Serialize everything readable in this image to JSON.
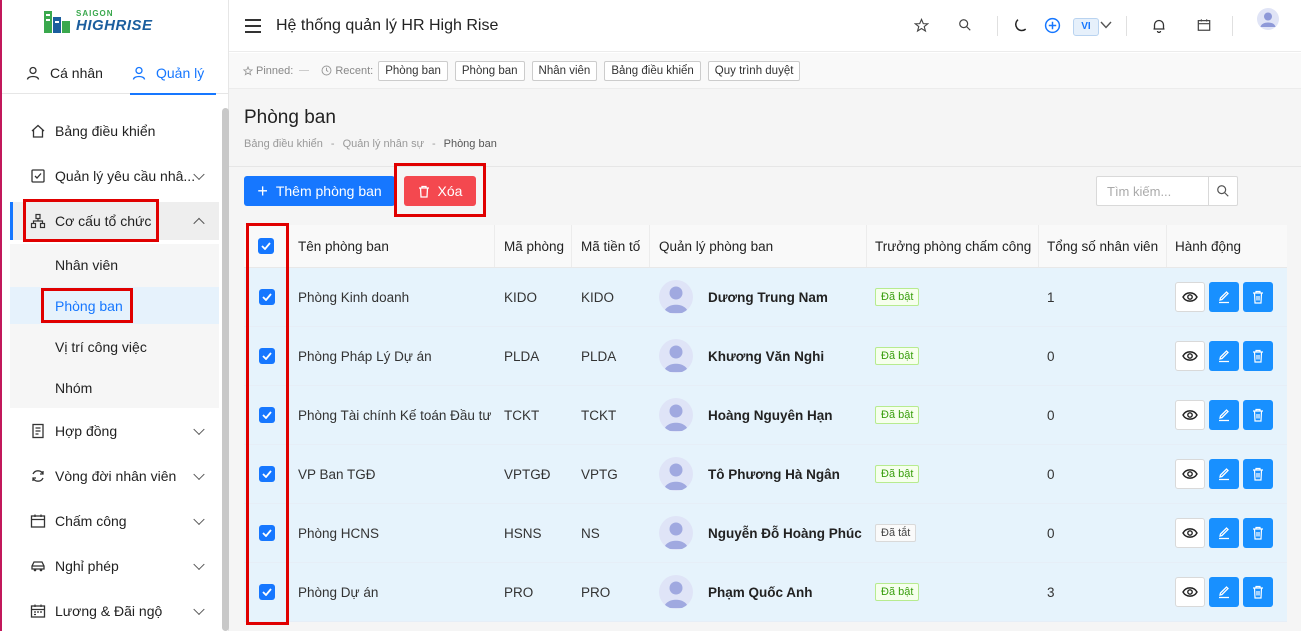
{
  "logo": {
    "sub": "SAIGON",
    "main": "HIGHRISE"
  },
  "sidebar": {
    "tabs": [
      {
        "label": "Cá nhân"
      },
      {
        "label": "Quản lý"
      }
    ],
    "items": [
      {
        "label": "Bảng điều khiển",
        "icon": "home-icon"
      },
      {
        "label": "Quản lý yêu cầu nhâ...",
        "icon": "checkbox-icon"
      },
      {
        "label": "Cơ cấu tổ chức",
        "icon": "org-chart-icon"
      },
      {
        "label": "Hợp đồng",
        "icon": "document-icon"
      },
      {
        "label": "Vòng đời nhân viên",
        "icon": "cycle-icon"
      },
      {
        "label": "Chấm công",
        "icon": "calendar-check-icon"
      },
      {
        "label": "Nghỉ phép",
        "icon": "car-icon"
      },
      {
        "label": "Lương & Đãi ngộ",
        "icon": "calendar-icon"
      }
    ],
    "submenu": [
      {
        "label": "Nhân viên"
      },
      {
        "label": "Phòng ban"
      },
      {
        "label": "Vị trí công việc"
      },
      {
        "label": "Nhóm"
      }
    ]
  },
  "header": {
    "title": "Hệ thống quản lý HR High Rise",
    "lang": "VI"
  },
  "recent_bar": {
    "pinned_label": "Pinned:",
    "recent_label": "Recent:",
    "chips": [
      "Phòng ban",
      "Phòng ban",
      "Nhân viên",
      "Bảng điều khiển",
      "Quy trình duyệt"
    ]
  },
  "page": {
    "title": "Phòng ban",
    "breadcrumb": [
      "Bảng điều khiển",
      "Quản lý nhân sự",
      "Phòng ban"
    ],
    "add_button": "Thêm phòng ban",
    "delete_button": "Xóa",
    "search_placeholder": "Tìm kiếm..."
  },
  "table": {
    "columns": [
      "Tên phòng ban",
      "Mã phòng",
      "Mã tiền tố",
      "Quản lý phòng ban",
      "Trưởng phòng chấm công",
      "Tổng số nhân viên",
      "Hành động"
    ],
    "rows": [
      {
        "name": "Phòng Kinh doanh",
        "code": "KIDO",
        "prefix": "KIDO",
        "manager": "Dương Trung Nam",
        "status": "Đã bật",
        "status_on": true,
        "total": "1",
        "checked": true
      },
      {
        "name": "Phòng Pháp Lý Dự án",
        "code": "PLDA",
        "prefix": "PLDA",
        "manager": "Khương Văn Nghi",
        "status": "Đã bật",
        "status_on": true,
        "total": "0",
        "checked": true
      },
      {
        "name": "Phòng Tài chính Kế toán Đầu tư",
        "code": "TCKT",
        "prefix": "TCKT",
        "manager": "Hoàng Nguyên Hạn",
        "status": "Đã bật",
        "status_on": true,
        "total": "0",
        "checked": true
      },
      {
        "name": "VP Ban TGĐ",
        "code": "VPTGĐ",
        "prefix": "VPTG",
        "manager": "Tô Phương Hà Ngân",
        "status": "Đã bật",
        "status_on": true,
        "total": "0",
        "checked": true
      },
      {
        "name": "Phòng HCNS",
        "code": "HSNS",
        "prefix": "NS",
        "manager": "Nguyễn Đỗ Hoàng Phúc",
        "status": "Đã tắt",
        "status_on": false,
        "total": "0",
        "checked": true
      },
      {
        "name": "Phòng Dự án",
        "code": "PRO",
        "prefix": "PRO",
        "manager": "Phạm Quốc Anh",
        "status": "Đã bật",
        "status_on": true,
        "total": "3",
        "checked": true
      }
    ]
  },
  "colors": {
    "accent": "#1677ff",
    "danger": "#f4484f",
    "highlight": "#e00000",
    "row_selected": "#e6f3fc"
  }
}
